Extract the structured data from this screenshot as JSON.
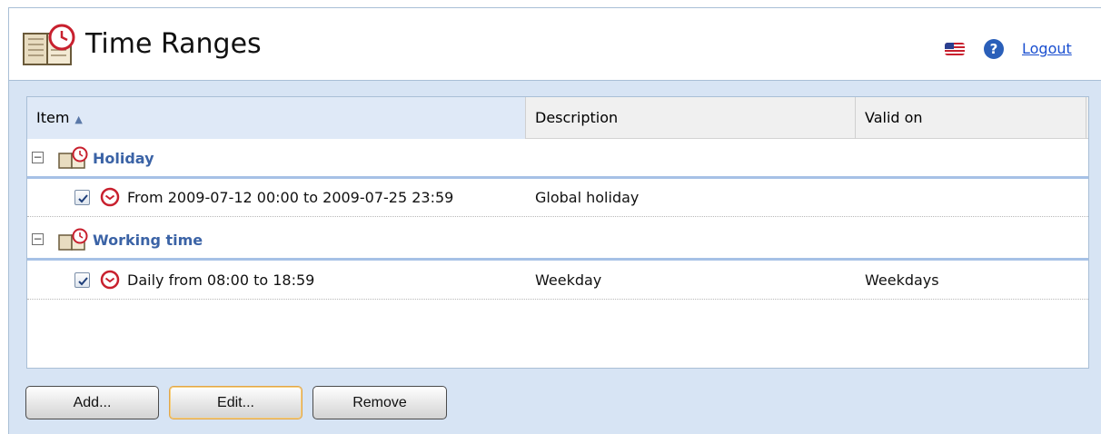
{
  "header": {
    "title": "Time Ranges",
    "app_icon": "book-clock-icon",
    "flag_icon": "us-flag-icon",
    "help_icon": "help-icon",
    "help_glyph": "?",
    "logout_label": "Logout"
  },
  "grid": {
    "columns": [
      {
        "label": "Item",
        "sort": "ascending"
      },
      {
        "label": "Description"
      },
      {
        "label": "Valid on"
      }
    ],
    "sort_glyph": "▲",
    "groups": [
      {
        "label": "Holiday",
        "toggle_glyph": "−",
        "icon": "book-clock-icon",
        "rows": [
          {
            "checked": true,
            "icon": "clock-icon",
            "item": "From 2009-07-12 00:00 to 2009-07-25 23:59",
            "description": "Global holiday",
            "valid_on": ""
          }
        ]
      },
      {
        "label": "Working time",
        "toggle_glyph": "−",
        "icon": "book-clock-icon",
        "rows": [
          {
            "checked": true,
            "icon": "clock-icon",
            "item": "Daily from 08:00 to 18:59",
            "description": "Weekday",
            "valid_on": "Weekdays"
          }
        ]
      }
    ]
  },
  "buttons": {
    "add": "Add...",
    "edit": "Edit...",
    "remove": "Remove"
  },
  "colors": {
    "accent": "#3b63a6",
    "clock_red": "#c8202e",
    "link": "#1a4fd0"
  }
}
